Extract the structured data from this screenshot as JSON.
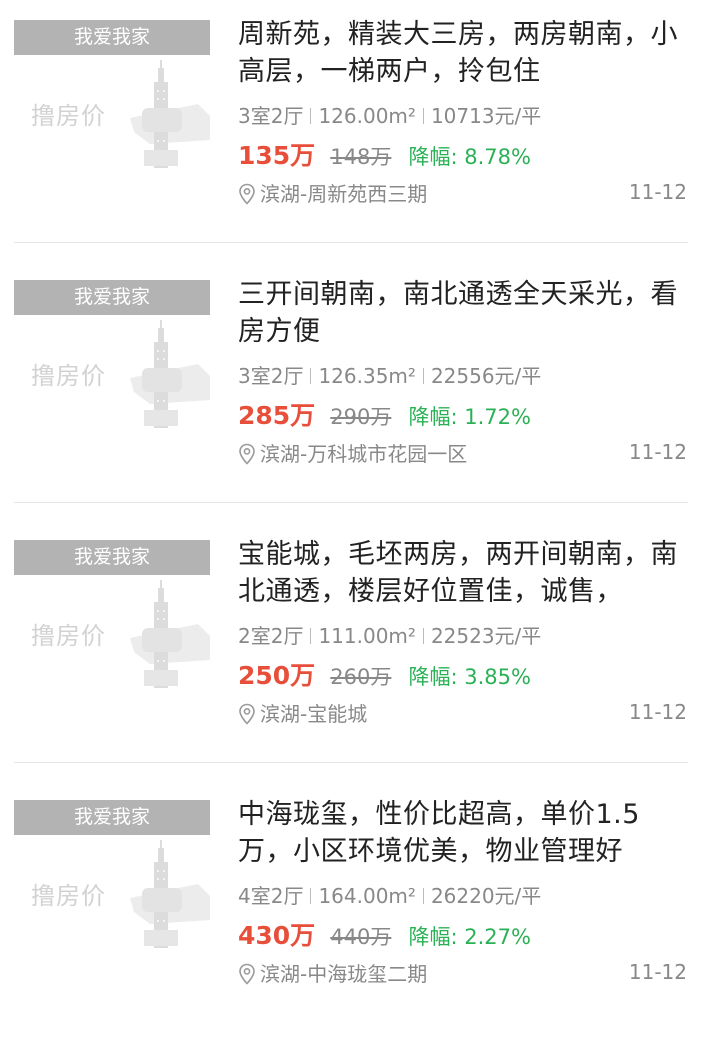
{
  "listings": [
    {
      "badge": "我爱我家",
      "placeholder": "撸房价",
      "title": "周新苑，精装大三房，两房朝南，小高层，一梯两户，拎包住",
      "layout": "3室2厅",
      "area": "126.00m²",
      "unit_price": "10713元/平",
      "price": "135万",
      "original_price": "148万",
      "drop": "降幅: 8.78%",
      "location": "滨湖-周新苑西三期",
      "date": "11-12"
    },
    {
      "badge": "我爱我家",
      "placeholder": "撸房价",
      "title": "三开间朝南，南北通透全天采光，看房方便",
      "layout": "3室2厅",
      "area": "126.35m²",
      "unit_price": "22556元/平",
      "price": "285万",
      "original_price": "290万",
      "drop": "降幅: 1.72%",
      "location": "滨湖-万科城市花园一区",
      "date": "11-12"
    },
    {
      "badge": "我爱我家",
      "placeholder": "撸房价",
      "title": "宝能城，毛坯两房，两开间朝南，南北通透，楼层好位置佳，诚售，",
      "layout": "2室2厅",
      "area": "111.00m²",
      "unit_price": "22523元/平",
      "price": "250万",
      "original_price": "260万",
      "drop": "降幅: 3.85%",
      "location": "滨湖-宝能城",
      "date": "11-12"
    },
    {
      "badge": "我爱我家",
      "placeholder": "撸房价",
      "title": "中海珑玺，性价比超高，单价1.5万，小区环境优美，物业管理好",
      "layout": "4室2厅",
      "area": "164.00m²",
      "unit_price": "26220元/平",
      "price": "430万",
      "original_price": "440万",
      "drop": "降幅: 2.27%",
      "location": "滨湖-中海珑玺二期",
      "date": "11-12"
    }
  ],
  "colors": {
    "price": "#e84f3b",
    "drop": "#2bb155",
    "badge_bg": "#b3b3b3",
    "muted": "#888888"
  },
  "icons": {
    "location": "location-pin-icon",
    "placeholder": "building-hand-icon"
  }
}
